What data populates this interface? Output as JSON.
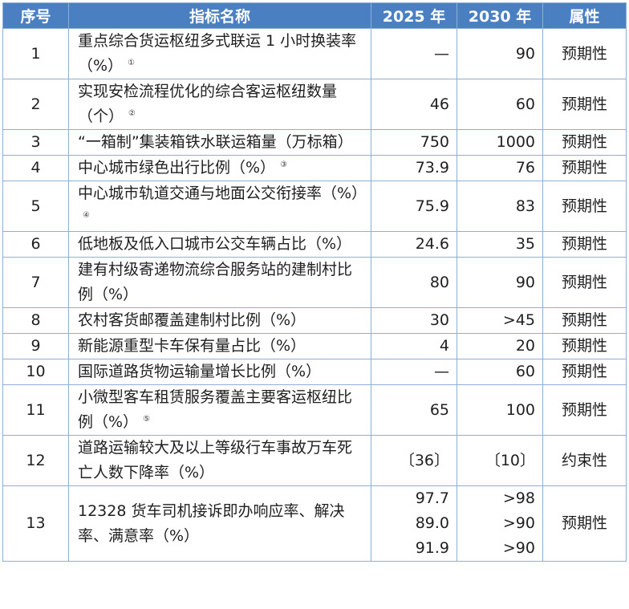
{
  "headers": {
    "no": "序号",
    "name": "指标名称",
    "y2025": "2025 年",
    "y2030": "2030 年",
    "attr": "属性"
  },
  "rows": [
    {
      "no": "1",
      "name": "重点综合货运枢纽多式联运 1 小时换装率（%）",
      "fn": "①",
      "y2025": "—",
      "y2030": "90",
      "attr": "预期性"
    },
    {
      "no": "2",
      "name": "实现安检流程优化的综合客运枢纽数量（个）",
      "fn": "②",
      "y2025": "46",
      "y2030": "60",
      "attr": "预期性"
    },
    {
      "no": "3",
      "name": "“一箱制”集装箱铁水联运箱量（万标箱）",
      "fn": "",
      "y2025": "750",
      "y2030": "1000",
      "attr": "预期性"
    },
    {
      "no": "4",
      "name": "中心城市绿色出行比例（%）",
      "fn": "③",
      "y2025": "73.9",
      "y2030": "76",
      "attr": "预期性"
    },
    {
      "no": "5",
      "name": "中心城市轨道交通与地面公交衔接率（%）",
      "fn": "④",
      "y2025": "75.9",
      "y2030": "83",
      "attr": "预期性"
    },
    {
      "no": "6",
      "name": "低地板及低入口城市公交车辆占比（%）",
      "fn": "",
      "y2025": "24.6",
      "y2030": "35",
      "attr": "预期性"
    },
    {
      "no": "7",
      "name": "建有村级寄递物流综合服务站的建制村比例（%）",
      "fn": "",
      "y2025": "80",
      "y2030": "90",
      "attr": "预期性"
    },
    {
      "no": "8",
      "name": "农村客货邮覆盖建制村比例（%）",
      "fn": "",
      "y2025": "30",
      "y2030": ">45",
      "attr": "预期性"
    },
    {
      "no": "9",
      "name": "新能源重型卡车保有量占比（%）",
      "fn": "",
      "y2025": "4",
      "y2030": "20",
      "attr": "预期性"
    },
    {
      "no": "10",
      "name": "国际道路货物运输量增长比例（%）",
      "fn": "",
      "y2025": "—",
      "y2030": "60",
      "attr": "预期性"
    },
    {
      "no": "11",
      "name": "小微型客车租赁服务覆盖主要客运枢纽比例（%）",
      "fn": "⑤",
      "y2025": "65",
      "y2030": "100",
      "attr": "预期性"
    },
    {
      "no": "12",
      "name": "道路运输较大及以上等级行车事故万车死亡人数下降率（%）",
      "fn": "",
      "y2025": "〔36〕",
      "y2030": "〔10〕",
      "attr": "约束性"
    }
  ],
  "row13": {
    "no": "13",
    "name": "12328 货车司机接诉即办响应率、解决率、满意率（%）",
    "y2025": [
      "97.7",
      "89.0",
      "91.9"
    ],
    "y2030": [
      ">98",
      ">90",
      ">90"
    ],
    "attr": "预期性"
  }
}
